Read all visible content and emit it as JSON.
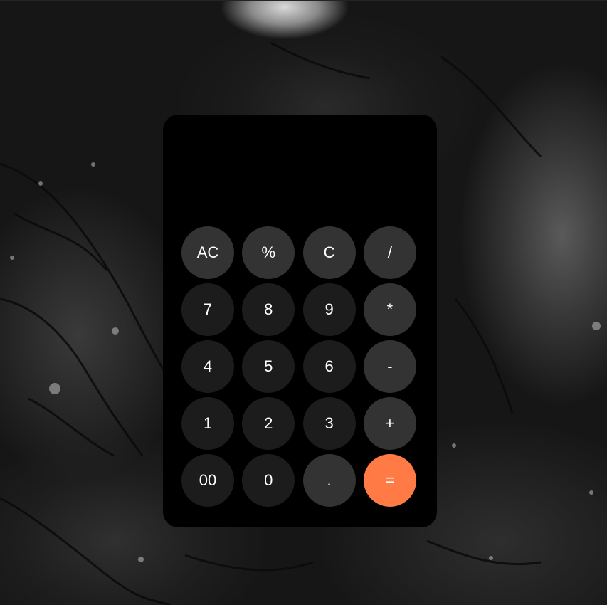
{
  "display": {
    "value": ""
  },
  "colors": {
    "number_key": "#1c1c1c",
    "function_key": "#333333",
    "equals_key": "#ff7a45",
    "calculator_bg": "#000000",
    "text": "#ffffff"
  },
  "keys": [
    {
      "label": "AC",
      "type": "func"
    },
    {
      "label": "%",
      "type": "func"
    },
    {
      "label": "C",
      "type": "func"
    },
    {
      "label": "/",
      "type": "func"
    },
    {
      "label": "7",
      "type": "num"
    },
    {
      "label": "8",
      "type": "num"
    },
    {
      "label": "9",
      "type": "num"
    },
    {
      "label": "*",
      "type": "func"
    },
    {
      "label": "4",
      "type": "num"
    },
    {
      "label": "5",
      "type": "num"
    },
    {
      "label": "6",
      "type": "num"
    },
    {
      "label": "-",
      "type": "func"
    },
    {
      "label": "1",
      "type": "num"
    },
    {
      "label": "2",
      "type": "num"
    },
    {
      "label": "3",
      "type": "num"
    },
    {
      "label": "+",
      "type": "func"
    },
    {
      "label": "00",
      "type": "num"
    },
    {
      "label": "0",
      "type": "num"
    },
    {
      "label": ".",
      "type": "func"
    },
    {
      "label": "=",
      "type": "equals"
    }
  ]
}
